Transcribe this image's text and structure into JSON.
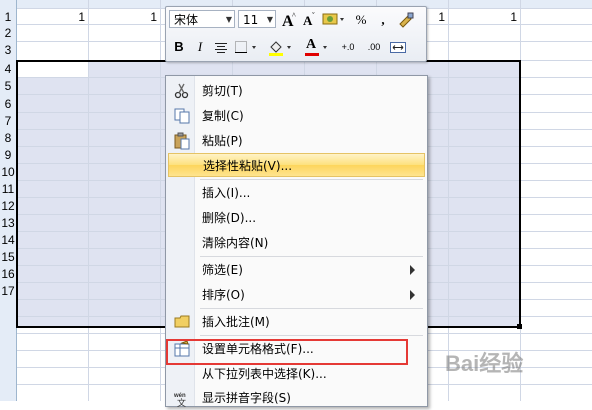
{
  "sheet": {
    "row_headers": [
      "1",
      "2",
      "3",
      "4",
      "5",
      "6",
      "7",
      "8",
      "9",
      "10",
      "11",
      "12",
      "13",
      "14",
      "15",
      "16",
      "17"
    ],
    "row1_values": [
      "1",
      "1",
      "1",
      "1"
    ]
  },
  "mini_toolbar": {
    "font_name": "宋体",
    "font_size": "11",
    "percent_label": "%",
    "comma_label": ",",
    "bold_label": "B",
    "italic_label": "I",
    "font_color_label": "A",
    "increase_decimal_label": "+.0",
    "decrease_decimal_label": ".00"
  },
  "context_menu": {
    "items": [
      {
        "label": "剪切(T)",
        "icon": "scissors-icon"
      },
      {
        "label": "复制(C)",
        "icon": "copy-icon"
      },
      {
        "label": "粘贴(P)",
        "icon": "paste-icon"
      },
      {
        "label": "选择性粘贴(V)...",
        "highlighted": true
      },
      {
        "label": "插入(I)..."
      },
      {
        "label": "删除(D)..."
      },
      {
        "label": "清除内容(N)"
      },
      {
        "label": "筛选(E)",
        "submenu": true
      },
      {
        "label": "排序(O)",
        "submenu": true
      },
      {
        "label": "插入批注(M)",
        "icon": "comment-icon"
      },
      {
        "label": "设置单元格格式(F)...",
        "icon": "format-cells-icon",
        "outlined": true
      },
      {
        "label": "从下拉列表中选择(K)..."
      },
      {
        "label": "显示拼音字段(S)",
        "icon": "phonetic-icon"
      }
    ]
  },
  "colors": {
    "selection_fill": "#dfe3f1",
    "highlight_outline": "#e53935",
    "menu_hover": "#fde17d"
  },
  "watermark": {
    "text": "Bai经验"
  }
}
